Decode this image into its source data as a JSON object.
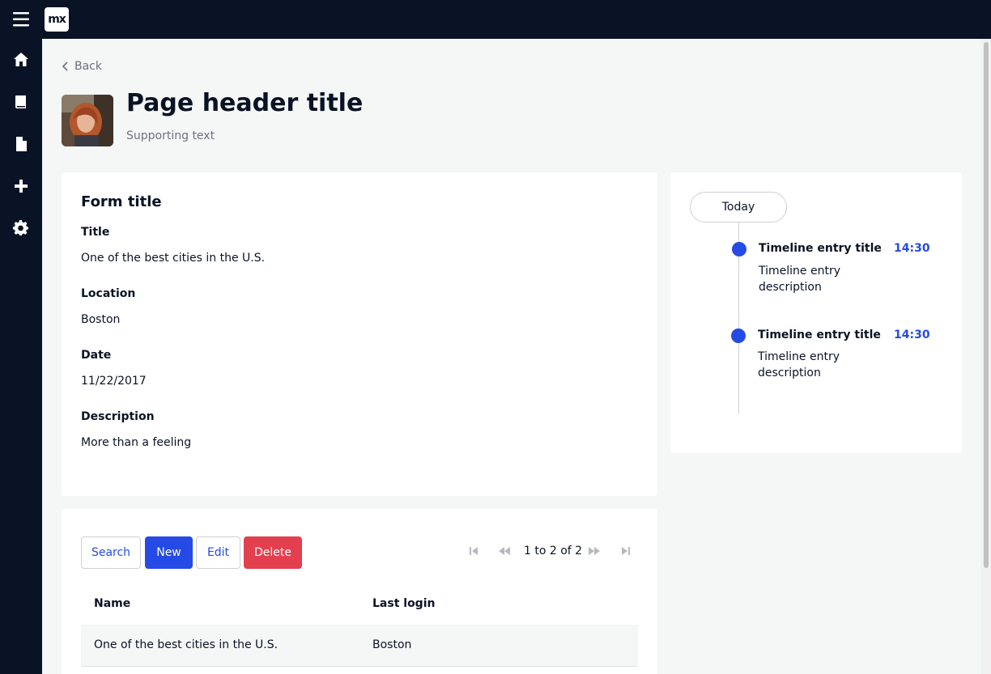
{
  "app": {
    "logo_text": "mx"
  },
  "sidebar": {
    "items": [
      {
        "icon": "home-icon"
      },
      {
        "icon": "book-icon"
      },
      {
        "icon": "file-icon"
      },
      {
        "icon": "plus-icon"
      },
      {
        "icon": "gear-icon"
      }
    ]
  },
  "header": {
    "back_label": "Back",
    "title": "Page header title",
    "subtitle": "Supporting text"
  },
  "form": {
    "title": "Form title",
    "fields": [
      {
        "label": "Title",
        "value": "One of the best cities in the U.S."
      },
      {
        "label": "Location",
        "value": "Boston"
      },
      {
        "label": "Date",
        "value": "11/22/2017"
      },
      {
        "label": "Description",
        "value": "More than a feeling"
      }
    ]
  },
  "timeline": {
    "group_label": "Today",
    "entries": [
      {
        "title": "Timeline entry title",
        "time": "14:30",
        "description": "Timeline entry description"
      },
      {
        "title": "Timeline entry title",
        "time": "14:30",
        "description": "Timeline entry description"
      }
    ]
  },
  "grid": {
    "buttons": {
      "search": "Search",
      "new": "New",
      "edit": "Edit",
      "delete": "Delete"
    },
    "pager_text": "1 to 2 of 2",
    "columns": [
      "Name",
      "Last login"
    ],
    "rows": [
      [
        "One of the best cities in the U.S.",
        "Boston"
      ]
    ]
  },
  "colors": {
    "nav_bg": "#0a1325",
    "accent": "#264ae5",
    "danger": "#e33f4e"
  }
}
